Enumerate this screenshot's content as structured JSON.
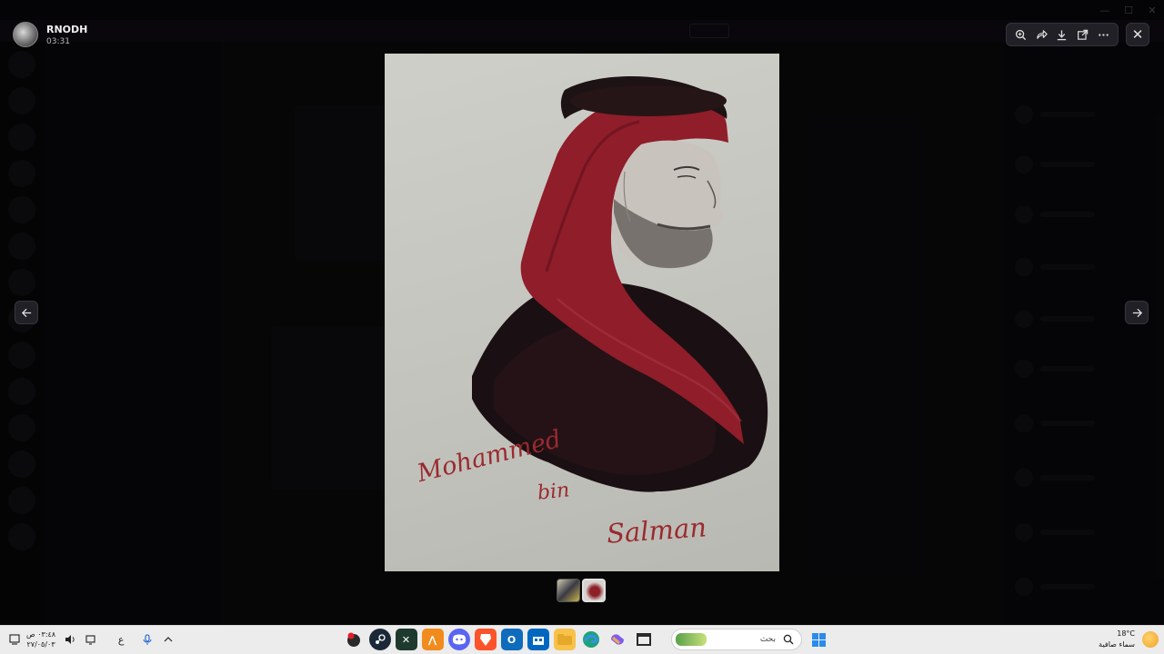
{
  "viewer": {
    "uploader": {
      "name": "RNODH",
      "time": "03:31"
    },
    "toolbar": {
      "zoom_icon": "zoom-in-icon",
      "forward_icon": "share-forward-icon",
      "download_icon": "download-icon",
      "open_icon": "open-external-icon",
      "more_icon": "more-icon",
      "close_icon": "close-icon"
    },
    "nav": {
      "prev_icon": "arrow-left-icon",
      "next_icon": "arrow-right-icon"
    },
    "artwork": {
      "signature_line1": "Mohammed",
      "signature_line2": "bin",
      "signature_line3": "Salman"
    },
    "thumbnails_count": 2
  },
  "taskbar": {
    "clock_time": "٠٣:٤٨ ص",
    "clock_date": "٢٧/٠٥/٠٣",
    "input_language": "ع",
    "search_label": "بحث",
    "weather_temp": "18°C",
    "weather_desc": "سماء صافية"
  },
  "colors": {
    "overlay": "#000000",
    "accent": "#2b8be8",
    "signature": "#9a2a2e",
    "headdress_red": "#9b1e2c"
  }
}
